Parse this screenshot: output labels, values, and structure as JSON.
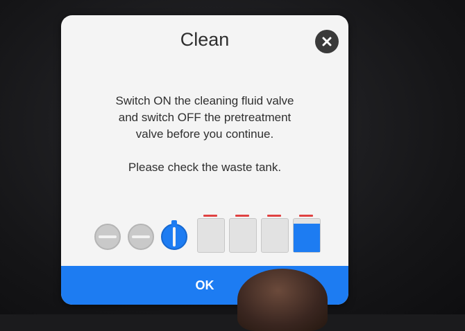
{
  "dialog": {
    "title": "Clean",
    "close_icon": "close-icon",
    "message_lines": [
      "Switch ON the cleaning fluid valve",
      "and switch OFF the pretreatment",
      "valve before you continue."
    ],
    "waste_message": "Please check the waste tank.",
    "ok_label": "OK"
  },
  "indicators": {
    "valves": [
      {
        "name": "valve-1",
        "state": "off"
      },
      {
        "name": "valve-2",
        "state": "off"
      },
      {
        "name": "valve-3",
        "state": "on"
      }
    ],
    "tanks": [
      {
        "name": "tank-1",
        "fill_fraction": 0.0
      },
      {
        "name": "tank-2",
        "fill_fraction": 0.0
      },
      {
        "name": "tank-3",
        "fill_fraction": 0.0
      },
      {
        "name": "tank-4",
        "fill_fraction": 0.85
      }
    ]
  },
  "colors": {
    "accent": "#1d7cf2",
    "level_mark": "#e04242",
    "dialog_background": "#f4f4f4"
  }
}
